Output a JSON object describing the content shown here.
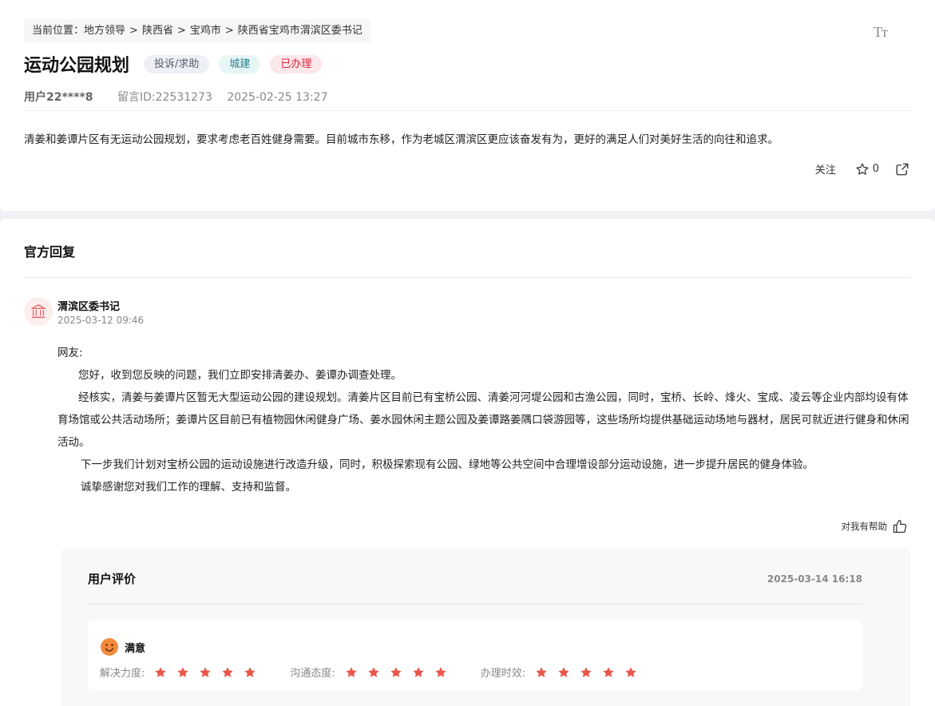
{
  "breadcrumb": {
    "prefix": "当前位置：",
    "items": [
      "地方领导",
      "陕西省",
      "宝鸡市",
      "陕西省宝鸡市渭滨区委书记"
    ],
    "separator": ">"
  },
  "font_toggle": {
    "label": "Tт"
  },
  "question": {
    "title": "运动公园规划",
    "tags": {
      "type": "投诉/求助",
      "category": "城建",
      "status": "已办理"
    },
    "user": "用户22****8",
    "message_id": "留言ID:22531273",
    "datetime": "2025-02-25 13:27",
    "content": "清姜和姜谭片区有无运动公园规划，要求考虑老百姓健身需要。目前城市东移，作为老城区渭滨区更应该奋发有为，更好的满足人们对美好生活的向往和追求。",
    "follow_label": "关注",
    "star_count": "0"
  },
  "reply": {
    "heading": "官方回复",
    "department": "渭滨区委书记",
    "datetime": "2025-03-12 09:46",
    "greeting": "网友:",
    "para1": "您好，收到您反映的问题，我们立即安排清姜办、姜谭办调查处理。",
    "para2": "经核实，清姜与姜谭片区暂无大型运动公园的建设规划。清姜片区目前已有宝桥公园、清姜河河堤公园和古渔公园，同时，宝桥、长岭、烽火、宝成、凌云等企业内部均设有体育场馆或公共活动场所；姜谭片区目前已有植物园休闲健身广场、姜水园休闲主题公园及姜谭路姜隅口袋游园等，这些场所均提供基础运动场地与器材，居民可就近进行健身和休闲活动。",
    "para3": "下一步我们计划对宝桥公园的运动设施进行改造升级，同时，积极探索现有公园、绿地等公共空间中合理增设部分运动设施，进一步提升居民的健身体验。",
    "para4": "诚挚感谢您对我们工作的理解、支持和监督。",
    "helpful_label": "对我有帮助"
  },
  "evaluation": {
    "heading": "用户评价",
    "datetime": "2025-03-14 16:18",
    "satisfaction": "满意",
    "ratings": [
      {
        "label": "解决力度:",
        "stars": 5
      },
      {
        "label": "沟通态度:",
        "stars": 5
      },
      {
        "label": "办理时效:",
        "stars": 5
      }
    ]
  },
  "colors": {
    "star": "#e8574a",
    "status_red": "#d2283f",
    "emoji": "#f48a3c"
  }
}
